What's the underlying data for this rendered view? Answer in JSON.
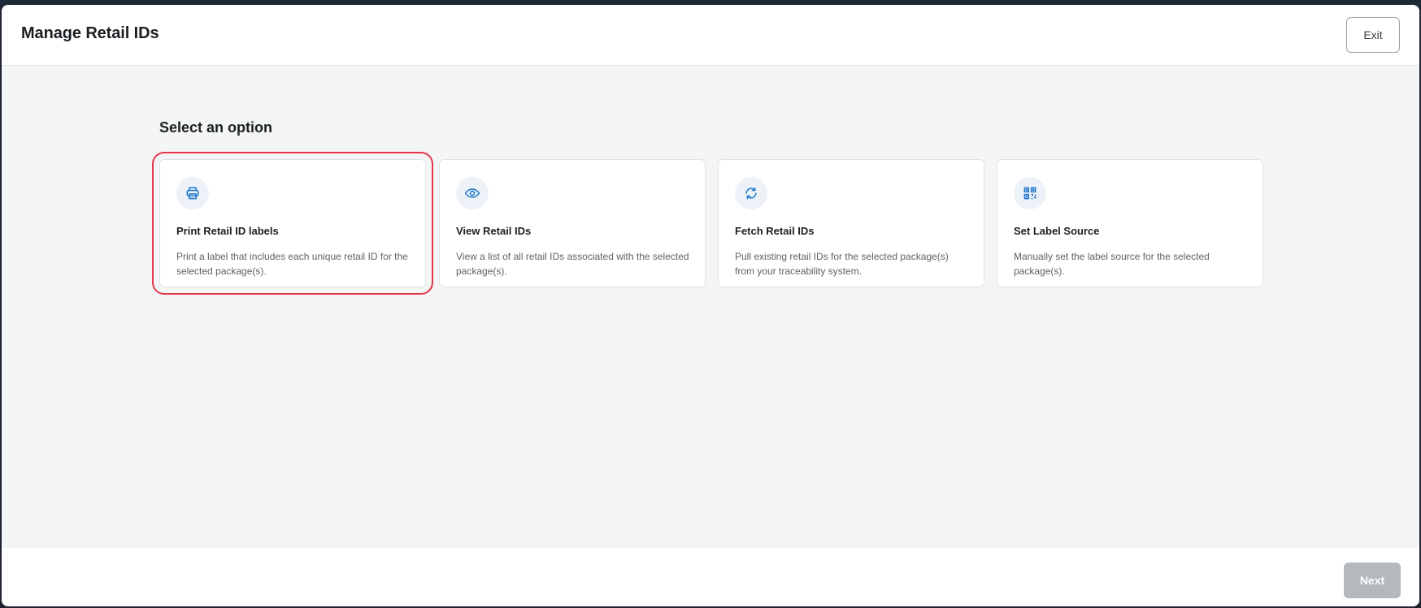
{
  "modal": {
    "title": "Manage Retail IDs",
    "exit_label": "Exit",
    "next_label": "Next"
  },
  "body": {
    "section_title": "Select an option",
    "options": [
      {
        "title": "Print Retail ID labels",
        "description": "Print a label that includes each unique retail ID for the selected package(s).",
        "icon": "printer-icon",
        "selected": true
      },
      {
        "title": "View Retail IDs",
        "description": "View a list of all retail IDs associated with the selected package(s).",
        "icon": "eye-icon",
        "selected": false
      },
      {
        "title": "Fetch Retail IDs",
        "description": "Pull existing retail IDs for the selected package(s) from your traceability system.",
        "icon": "refresh-icon",
        "selected": false
      },
      {
        "title": "Set Label Source",
        "description": "Manually set the label source for the selected package(s).",
        "icon": "qr-code-icon",
        "selected": false
      }
    ]
  },
  "colors": {
    "accent": "#1a73c9",
    "selected_outline": "#e5364d",
    "disabled_button": "#b4b9bd",
    "body_background": "#f4f5f5"
  }
}
